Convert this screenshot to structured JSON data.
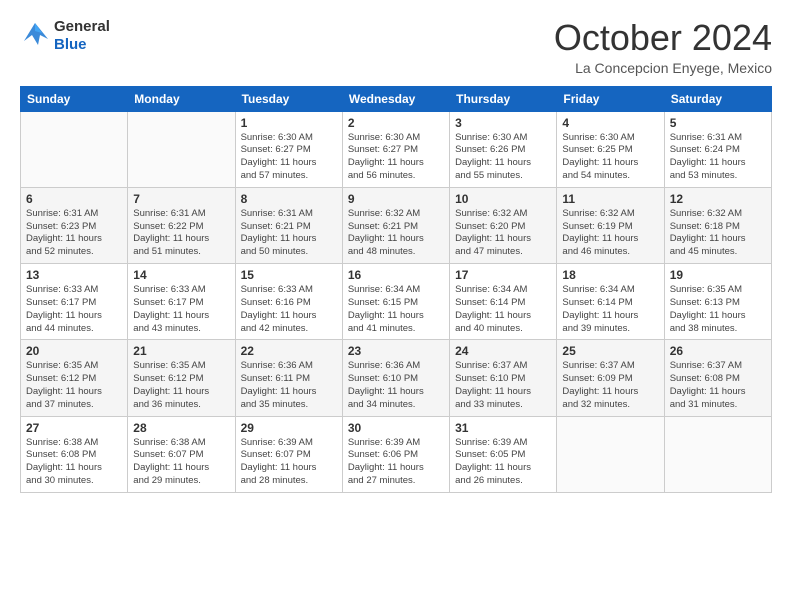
{
  "logo": {
    "line1": "General",
    "line2": "Blue"
  },
  "title": "October 2024",
  "location": "La Concepcion Enyege, Mexico",
  "weekdays": [
    "Sunday",
    "Monday",
    "Tuesday",
    "Wednesday",
    "Thursday",
    "Friday",
    "Saturday"
  ],
  "weeks": [
    [
      {
        "day": "",
        "info": ""
      },
      {
        "day": "",
        "info": ""
      },
      {
        "day": "1",
        "info": "Sunrise: 6:30 AM\nSunset: 6:27 PM\nDaylight: 11 hours\nand 57 minutes."
      },
      {
        "day": "2",
        "info": "Sunrise: 6:30 AM\nSunset: 6:27 PM\nDaylight: 11 hours\nand 56 minutes."
      },
      {
        "day": "3",
        "info": "Sunrise: 6:30 AM\nSunset: 6:26 PM\nDaylight: 11 hours\nand 55 minutes."
      },
      {
        "day": "4",
        "info": "Sunrise: 6:30 AM\nSunset: 6:25 PM\nDaylight: 11 hours\nand 54 minutes."
      },
      {
        "day": "5",
        "info": "Sunrise: 6:31 AM\nSunset: 6:24 PM\nDaylight: 11 hours\nand 53 minutes."
      }
    ],
    [
      {
        "day": "6",
        "info": "Sunrise: 6:31 AM\nSunset: 6:23 PM\nDaylight: 11 hours\nand 52 minutes."
      },
      {
        "day": "7",
        "info": "Sunrise: 6:31 AM\nSunset: 6:22 PM\nDaylight: 11 hours\nand 51 minutes."
      },
      {
        "day": "8",
        "info": "Sunrise: 6:31 AM\nSunset: 6:21 PM\nDaylight: 11 hours\nand 50 minutes."
      },
      {
        "day": "9",
        "info": "Sunrise: 6:32 AM\nSunset: 6:21 PM\nDaylight: 11 hours\nand 48 minutes."
      },
      {
        "day": "10",
        "info": "Sunrise: 6:32 AM\nSunset: 6:20 PM\nDaylight: 11 hours\nand 47 minutes."
      },
      {
        "day": "11",
        "info": "Sunrise: 6:32 AM\nSunset: 6:19 PM\nDaylight: 11 hours\nand 46 minutes."
      },
      {
        "day": "12",
        "info": "Sunrise: 6:32 AM\nSunset: 6:18 PM\nDaylight: 11 hours\nand 45 minutes."
      }
    ],
    [
      {
        "day": "13",
        "info": "Sunrise: 6:33 AM\nSunset: 6:17 PM\nDaylight: 11 hours\nand 44 minutes."
      },
      {
        "day": "14",
        "info": "Sunrise: 6:33 AM\nSunset: 6:17 PM\nDaylight: 11 hours\nand 43 minutes."
      },
      {
        "day": "15",
        "info": "Sunrise: 6:33 AM\nSunset: 6:16 PM\nDaylight: 11 hours\nand 42 minutes."
      },
      {
        "day": "16",
        "info": "Sunrise: 6:34 AM\nSunset: 6:15 PM\nDaylight: 11 hours\nand 41 minutes."
      },
      {
        "day": "17",
        "info": "Sunrise: 6:34 AM\nSunset: 6:14 PM\nDaylight: 11 hours\nand 40 minutes."
      },
      {
        "day": "18",
        "info": "Sunrise: 6:34 AM\nSunset: 6:14 PM\nDaylight: 11 hours\nand 39 minutes."
      },
      {
        "day": "19",
        "info": "Sunrise: 6:35 AM\nSunset: 6:13 PM\nDaylight: 11 hours\nand 38 minutes."
      }
    ],
    [
      {
        "day": "20",
        "info": "Sunrise: 6:35 AM\nSunset: 6:12 PM\nDaylight: 11 hours\nand 37 minutes."
      },
      {
        "day": "21",
        "info": "Sunrise: 6:35 AM\nSunset: 6:12 PM\nDaylight: 11 hours\nand 36 minutes."
      },
      {
        "day": "22",
        "info": "Sunrise: 6:36 AM\nSunset: 6:11 PM\nDaylight: 11 hours\nand 35 minutes."
      },
      {
        "day": "23",
        "info": "Sunrise: 6:36 AM\nSunset: 6:10 PM\nDaylight: 11 hours\nand 34 minutes."
      },
      {
        "day": "24",
        "info": "Sunrise: 6:37 AM\nSunset: 6:10 PM\nDaylight: 11 hours\nand 33 minutes."
      },
      {
        "day": "25",
        "info": "Sunrise: 6:37 AM\nSunset: 6:09 PM\nDaylight: 11 hours\nand 32 minutes."
      },
      {
        "day": "26",
        "info": "Sunrise: 6:37 AM\nSunset: 6:08 PM\nDaylight: 11 hours\nand 31 minutes."
      }
    ],
    [
      {
        "day": "27",
        "info": "Sunrise: 6:38 AM\nSunset: 6:08 PM\nDaylight: 11 hours\nand 30 minutes."
      },
      {
        "day": "28",
        "info": "Sunrise: 6:38 AM\nSunset: 6:07 PM\nDaylight: 11 hours\nand 29 minutes."
      },
      {
        "day": "29",
        "info": "Sunrise: 6:39 AM\nSunset: 6:07 PM\nDaylight: 11 hours\nand 28 minutes."
      },
      {
        "day": "30",
        "info": "Sunrise: 6:39 AM\nSunset: 6:06 PM\nDaylight: 11 hours\nand 27 minutes."
      },
      {
        "day": "31",
        "info": "Sunrise: 6:39 AM\nSunset: 6:05 PM\nDaylight: 11 hours\nand 26 minutes."
      },
      {
        "day": "",
        "info": ""
      },
      {
        "day": "",
        "info": ""
      }
    ]
  ]
}
